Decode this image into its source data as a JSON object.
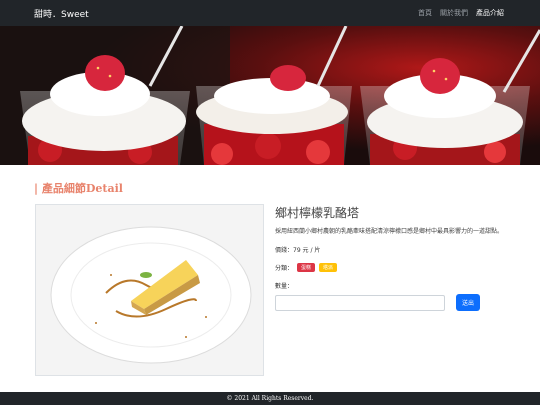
{
  "navbar": {
    "brand": "甜時．Sweet",
    "links": [
      {
        "label": "首頁",
        "active": false
      },
      {
        "label": "關於我們",
        "active": false
      },
      {
        "label": "產品介紹",
        "active": true
      }
    ]
  },
  "section": {
    "title": "| 產品細節Detail"
  },
  "product": {
    "name": "鄉村檸檬乳酪塔",
    "description": "採用紐西蘭小鄉村農朝的乳酪牽味搭配清涼檸檬口感是鄉村中最具影響力的一道甜點。",
    "price": "價錢：79 元 / 片",
    "category_label": "分類：",
    "badges": [
      {
        "label": "蛋糕",
        "color": "#dc3545"
      },
      {
        "label": "塔派",
        "color": "#ffc107"
      }
    ],
    "quantity_label": "數量：",
    "quantity_value": "",
    "submit_label": "送出"
  },
  "footer": {
    "copyright": "© 2021 All Rights Reserved."
  },
  "colors": {
    "navbar_bg": "#212529",
    "accent_title": "#e8836c",
    "button_primary": "#0d6efd"
  }
}
